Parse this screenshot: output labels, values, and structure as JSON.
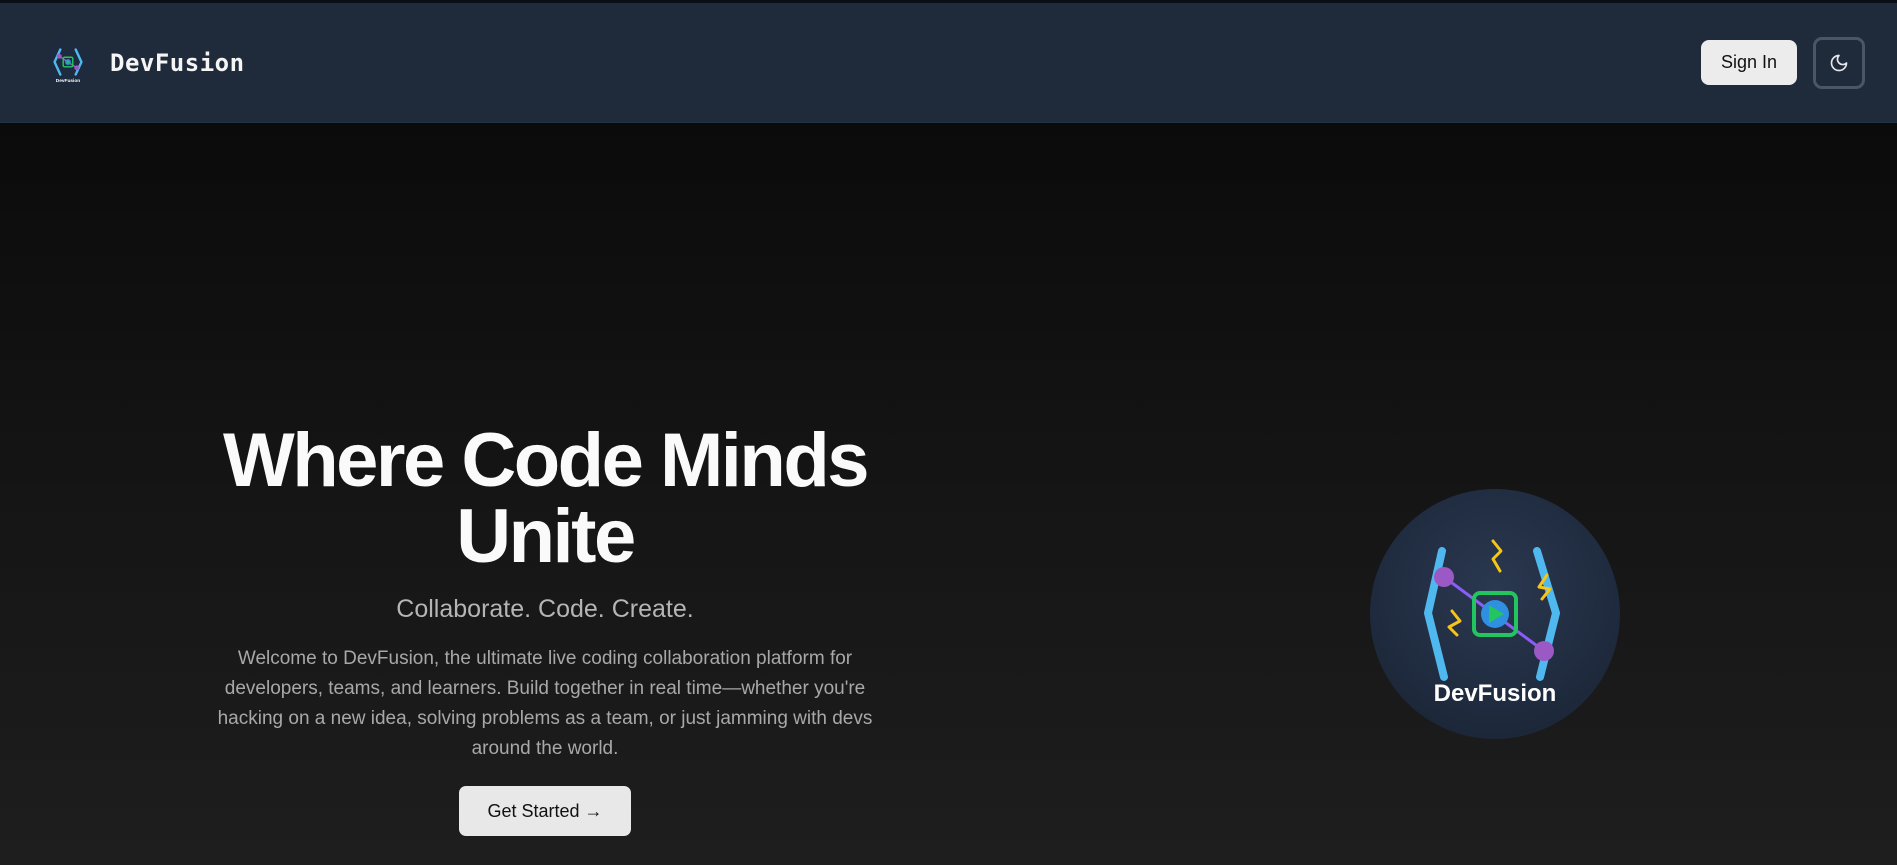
{
  "navbar": {
    "brand_name": "DevFusion",
    "logo_caption": "DevFusion",
    "signin_label": "Sign In",
    "theme_toggle_icon": "moon-icon"
  },
  "hero": {
    "title": "Where Code Minds Unite",
    "subtitle": "Collaborate. Code. Create.",
    "description": "Welcome to DevFusion, the ultimate live coding collaboration platform for developers, teams, and learners. Build together in real time—whether you're hacking on a new idea, solving problems as a team, or just jamming with devs around the world.",
    "cta_label": "Get Started →",
    "logo_text": "DevFusion"
  },
  "colors": {
    "navbar_bg": "#1f2a3b",
    "hero_bg_top": "#0b0b0b",
    "hero_bg_bottom": "#1e1e1e",
    "logo_circle": "#1e2a3d",
    "bracket_blue": "#4fb8ee",
    "node_purple": "#9b59c6",
    "bolt_yellow": "#f5c518",
    "play_green": "#22c55e"
  }
}
